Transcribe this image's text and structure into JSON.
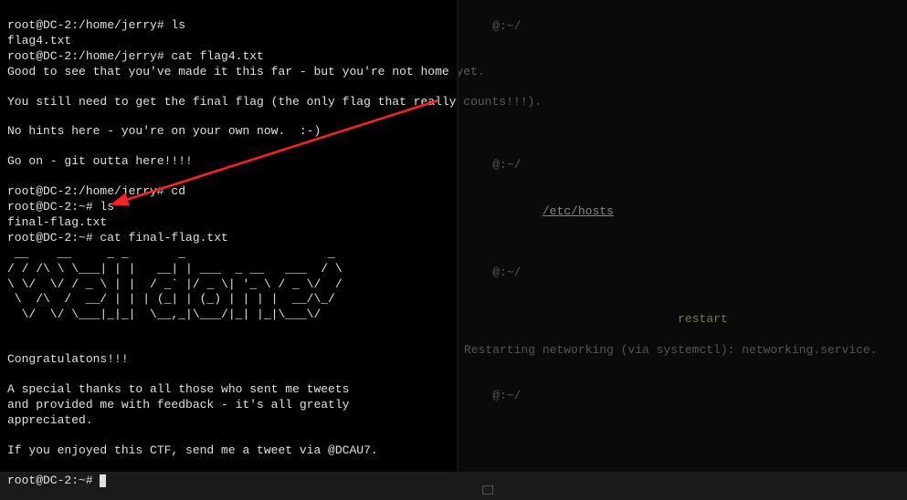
{
  "left": {
    "line00": "",
    "line01": "root@DC-2:/home/jerry# ls",
    "line02": "flag4.txt",
    "line03": "root@DC-2:/home/jerry# cat flag4.txt",
    "line04": "Good to see that you've made it this far - but you're not home yet.",
    "line05": "",
    "line06": "You still need to get the final flag (the only flag that really counts!!!).",
    "line07": "",
    "line08": "No hints here - you're on your own now.  :-)",
    "line09": "",
    "line10": "Go on - git outta here!!!!",
    "line11": "",
    "line12": "root@DC-2:/home/jerry# cd",
    "line13": "root@DC-2:~# ls",
    "line14": "final-flag.txt",
    "line15": "root@DC-2:~# cat final-flag.txt",
    "line16": " __    __     _ _       _                    _ ",
    "line17": "/ / /\\ \\ \\___| | |   __| | ___  _ __   ___  / \\",
    "line18": "\\ \\/  \\/ / _ \\ | |  / _` |/ _ \\| '_ \\ / _ \\/  /",
    "line19": " \\  /\\  /  __/ | | | (_| | (_) | | | |  __/\\_/ ",
    "line20": "  \\/  \\/ \\___|_|_|  \\__,_|\\___/|_| |_|\\___\\/   ",
    "line21": "",
    "line22": "",
    "line23": "Congratulatons!!!",
    "line24": "",
    "line25": "A special thanks to all those who sent me tweets",
    "line26": "and provided me with feedback - it's all greatly",
    "line27": "appreciated.",
    "line28": "",
    "line29": "If you enjoyed this CTF, send me a tweet via @DCAU7.",
    "line30": "",
    "final_prompt": "root@DC-2:~# "
  },
  "right": {
    "r1u": "",
    "r1h": "",
    "r1path": "~/",
    "r1sym": "",
    "r2": "",
    "r3u": "",
    "r3h": "",
    "r3path": "~/",
    "r3sym": "",
    "r4": "     ",
    "r4b": "/etc/hosts",
    "r5u": "",
    "r5h": "",
    "r5path": "~/",
    "r5sym": "",
    "r6a": "                        restart",
    "r7": "Restarting networking (via systemctl): networking.service.",
    "r8u": "",
    "r8h": "",
    "r8path": "~/",
    "r8sym": "",
    "r9": ""
  }
}
